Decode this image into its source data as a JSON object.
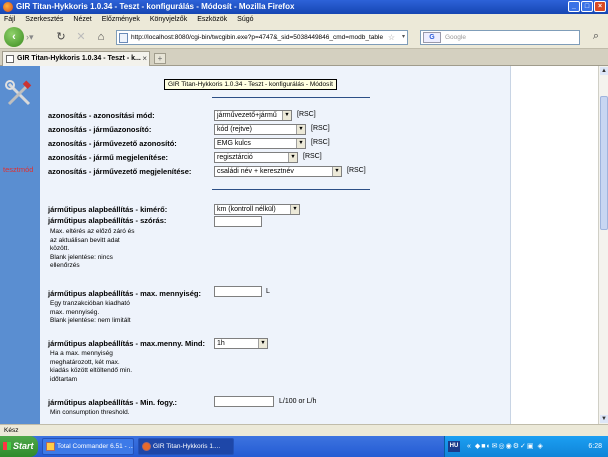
{
  "window": {
    "title": "GIR Titan-Hykkoris 1.0.34 - Teszt - konfigurálás - Módosít - Mozilla Firefox"
  },
  "menu": [
    "Fájl",
    "Szerkesztés",
    "Nézet",
    "Előzmények",
    "Könyvjelzők",
    "Eszközök",
    "Súgó"
  ],
  "nav": {
    "url": "http://localhost:8080/cgi-bin/twcgibin.exe?p=4747&_sid=5038449846_cmd=modb_table",
    "search_placeholder": "Google",
    "search_engine": "G"
  },
  "tab": {
    "label": "GIR Titan-Hykkoris 1.0.34 - Teszt - k...",
    "tooltip": "GIR Titan-Hykkoris 1.0.34 - Teszt - konfigurálás - Módosít"
  },
  "sidebar": {
    "mode_label": "tesztmód"
  },
  "section1": [
    {
      "label": "azonosítás - azonosítási mód:",
      "value": "járművezető+jármű",
      "rsc": "[RSC]"
    },
    {
      "label": "azonosítás - járműazonosító:",
      "value": "kód (rejtve)",
      "rsc": "[RSC]"
    },
    {
      "label": "azonosítás - járművezető azonosító:",
      "value": "EMG kulcs",
      "rsc": "[RSC]"
    },
    {
      "label": "azonosítás - jármű megjelenítése:",
      "value": "regisztárció",
      "rsc": "[RSC]"
    },
    {
      "label": "azonosítás - járművezető megjelenítése:",
      "value": "családi név + keresztnév",
      "rsc": "[RSC]"
    }
  ],
  "section2": {
    "kmero": {
      "label": "járműtipus alapbeállítás - kimérő:",
      "value": "km (kontroll nélkül)"
    },
    "szoras": {
      "label": "járműtipus alapbeállítás - szórás:",
      "desc": [
        "Max. eltérés az előző záró és",
        "az aktuálisan bevitt adat",
        "között.",
        "Blank jelentése: nincs",
        "ellenőrzés"
      ]
    },
    "maxmenny": {
      "label": "járműtipus alapbeállítás - max. mennyiség:",
      "unit": "L",
      "desc": [
        "Egy tranzakcióban kiadható",
        "max. mennyiség.",
        "Blank jelentése: nem limitált"
      ]
    },
    "maxmind": {
      "label": "járműtipus alapbeállítás - max.menny. Mind:",
      "value": "1h",
      "desc": [
        "Ha a max. mennyiség",
        "meghatározott, két max.",
        "kiadás között eltöltendő min.",
        "időtartam"
      ]
    },
    "minfogy": {
      "label": "járműtipus alapbeállítás - Min. fogy.:",
      "unit": "L/100 or L/h",
      "desc": [
        "Min consumption threshold."
      ]
    }
  },
  "status": {
    "text": "Kész"
  },
  "taskbar": {
    "start": "Start",
    "items": [
      "Total Commander 6.51 - ...",
      "GIR Titan-Hykkoris 1...."
    ],
    "lang": "HU",
    "clock": "6:28"
  }
}
